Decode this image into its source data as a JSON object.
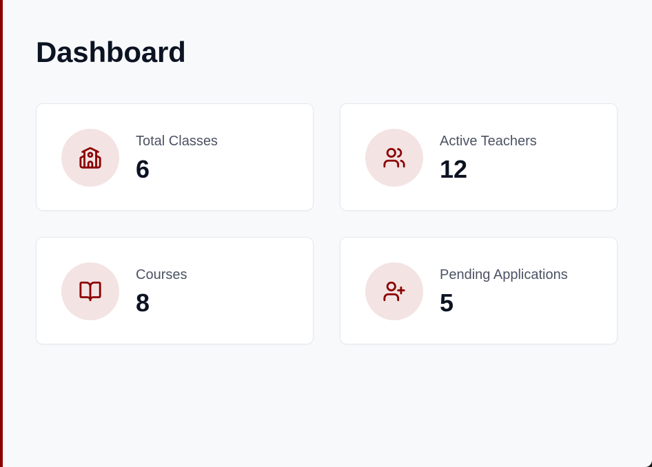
{
  "page": {
    "title": "Dashboard"
  },
  "stats": [
    {
      "label": "Total Classes",
      "value": "6",
      "icon": "school-icon"
    },
    {
      "label": "Active Teachers",
      "value": "12",
      "icon": "users-icon"
    },
    {
      "label": "Courses",
      "value": "8",
      "icon": "book-open-icon"
    },
    {
      "label": "Pending Applications",
      "value": "5",
      "icon": "user-plus-icon"
    }
  ],
  "colors": {
    "accent": "#8b0000",
    "icon_bg": "#f3e3e3",
    "page_bg": "#f8f9fb",
    "card_bg": "#ffffff",
    "title_text": "#0c1322",
    "label_text": "#4a5263"
  }
}
